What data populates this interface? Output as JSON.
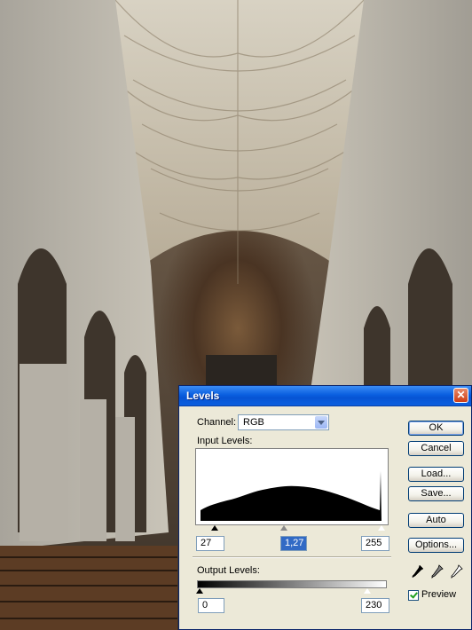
{
  "dialog": {
    "title": "Levels",
    "channel_label": "Channel:",
    "channel_value": "RGB",
    "input_levels_label": "Input Levels:",
    "input_black": "27",
    "input_gamma": "1,27",
    "input_white": "255",
    "output_levels_label": "Output Levels:",
    "output_black": "0",
    "output_white": "230",
    "buttons": {
      "ok": "OK",
      "cancel": "Cancel",
      "load": "Load...",
      "save": "Save...",
      "auto": "Auto",
      "options": "Options..."
    },
    "preview_label": "Preview",
    "preview_checked": true
  },
  "icons": {
    "close": "close-icon",
    "dropdown": "chevron-down-icon",
    "eyedroppers": [
      "black-eyedropper-icon",
      "gray-eyedropper-icon",
      "white-eyedropper-icon"
    ]
  }
}
